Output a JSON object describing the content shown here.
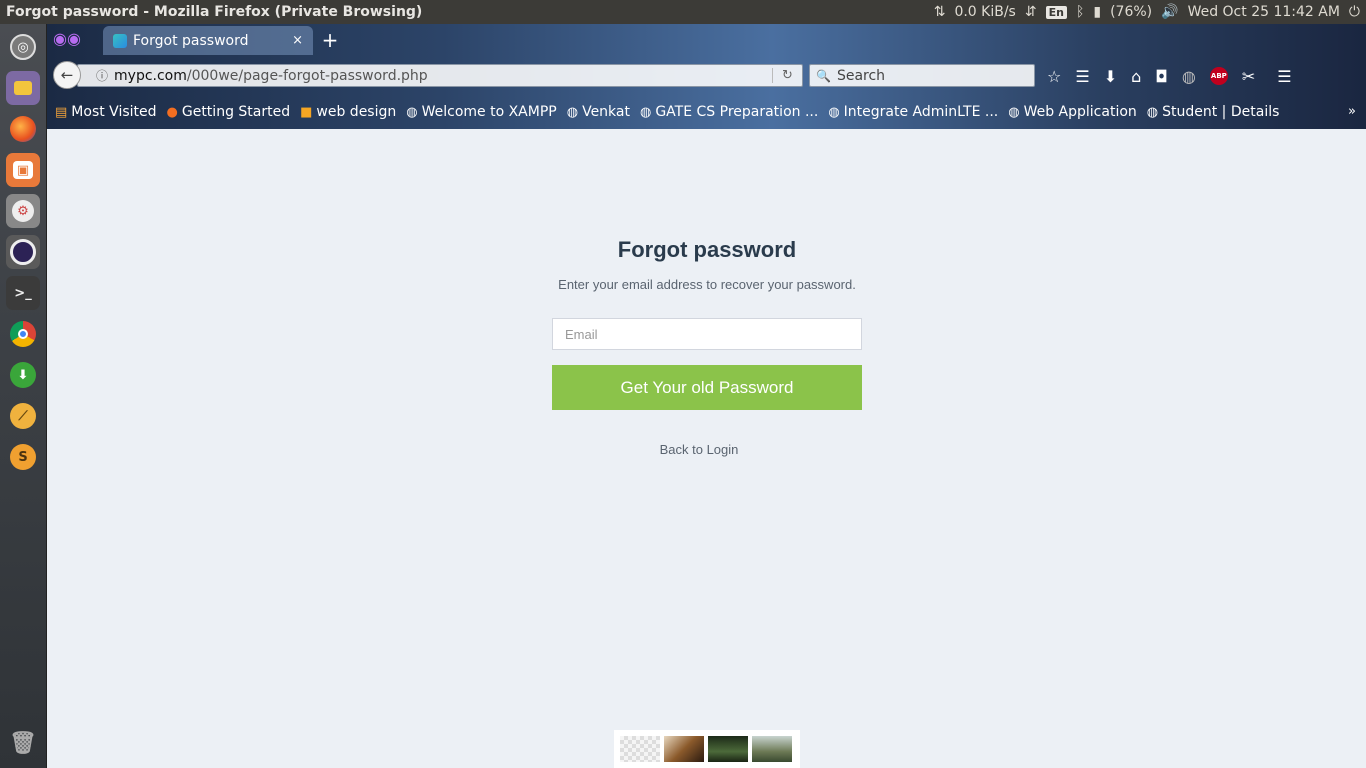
{
  "window": {
    "title": "Forgot password - Mozilla Firefox (Private Browsing)"
  },
  "system_tray": {
    "network_speed": "0.0 KiB/s",
    "keyboard_layout": "En",
    "battery": "(76%)",
    "datetime": "Wed Oct 25 11:42 AM"
  },
  "launcher": {
    "items": [
      "ubuntu-dash",
      "files",
      "firefox",
      "software-center",
      "settings",
      "eclipse",
      "terminal",
      "chrome",
      "downloader",
      "mysql-workbench",
      "sublime-text",
      "trash"
    ]
  },
  "browser": {
    "tab": {
      "title": "Forgot password",
      "close_glyph": "×"
    },
    "new_tab_glyph": "+",
    "url": {
      "host": "mypc.com",
      "path": "/000we/page-forgot-password.php"
    },
    "search": {
      "placeholder": "Search"
    },
    "bookmarks": [
      "Most Visited",
      "Getting Started",
      "web design",
      "Welcome to XAMPP",
      "Venkat",
      "GATE CS Preparation ...",
      "Integrate AdminLTE ...",
      "Web Application",
      "Student | Details"
    ],
    "bookmarks_overflow": "»"
  },
  "page": {
    "title": "Forgot password",
    "subtitle": "Enter your email address to recover your password.",
    "email_placeholder": "Email",
    "email_value": "",
    "submit_label": "Get Your old Password",
    "back_link": "Back to Login"
  },
  "colors": {
    "accent_green": "#8bc34a",
    "page_background": "#ecf0f5",
    "title_color": "#2a3b4c"
  }
}
